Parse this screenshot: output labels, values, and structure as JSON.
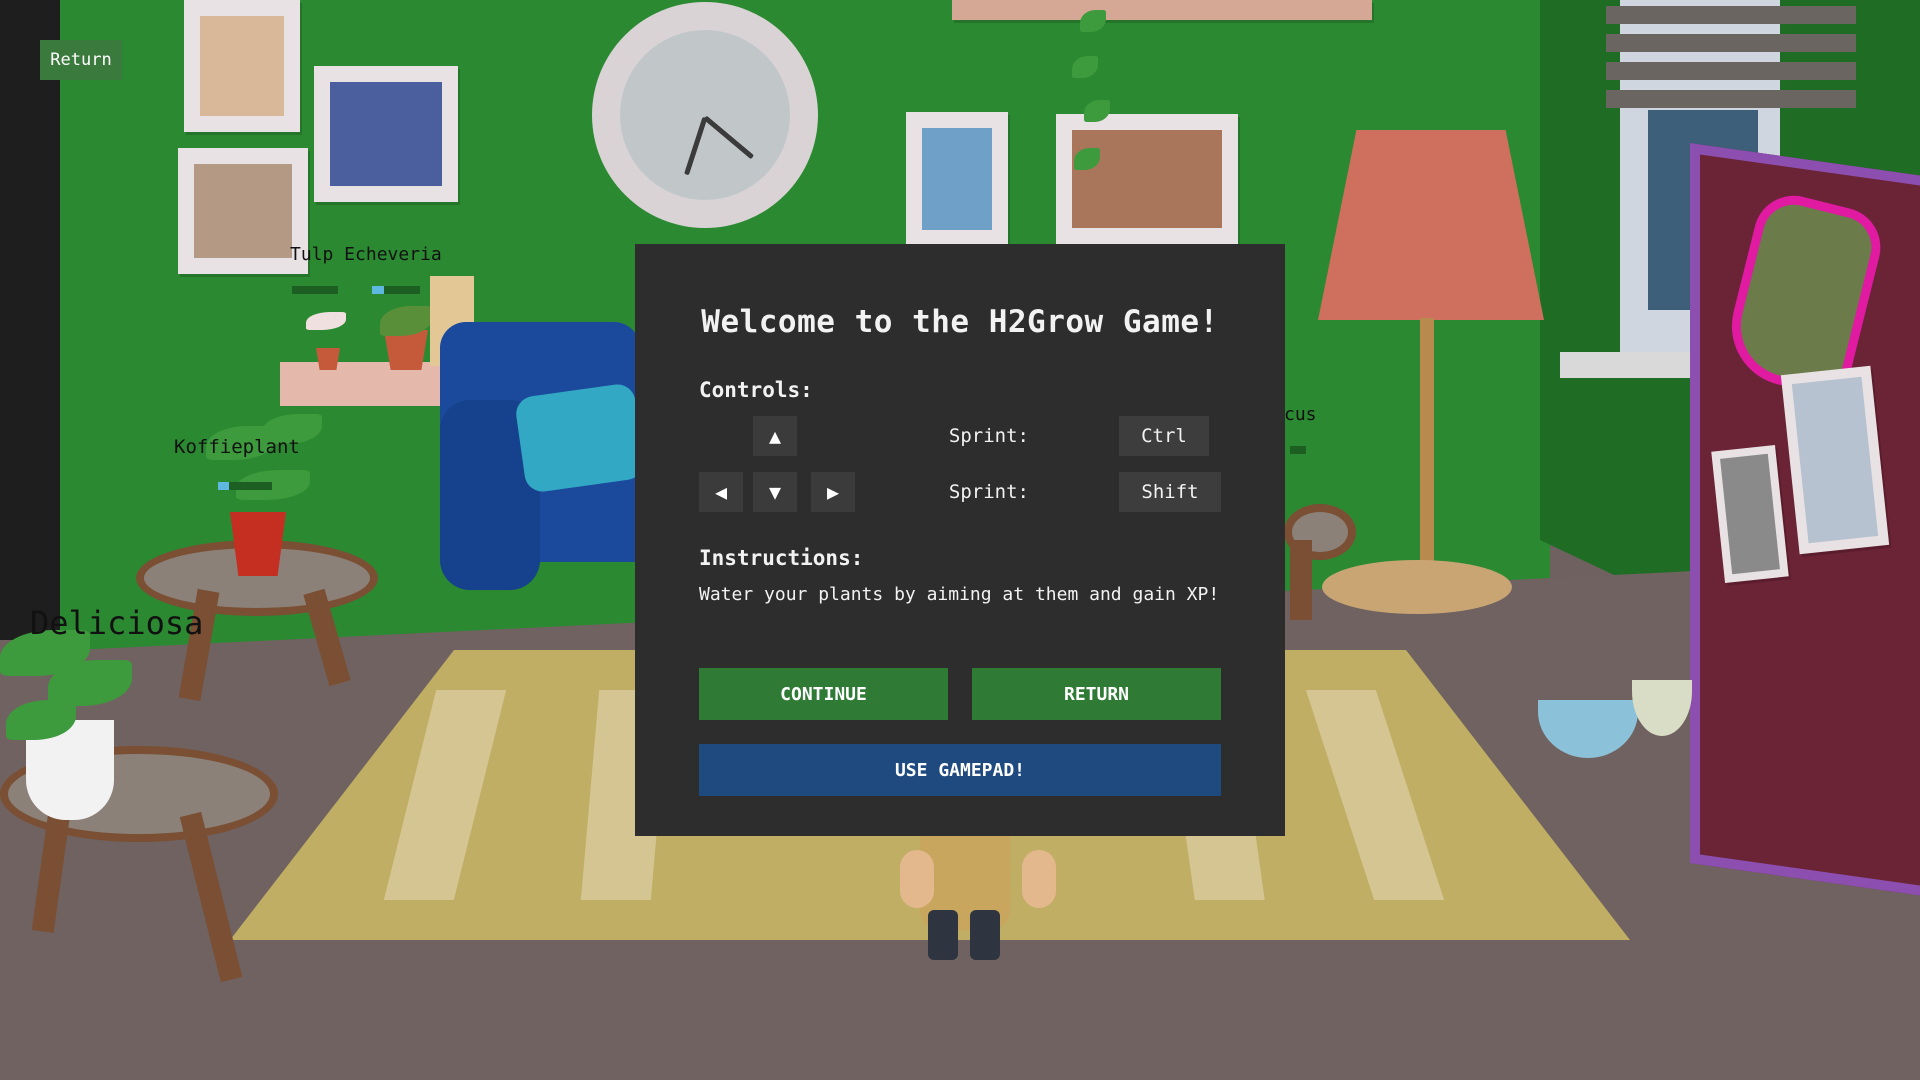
{
  "top_return_label": "Return",
  "world_labels": {
    "tulp": "Tulp Echeveria",
    "koffie": "Koffieplant",
    "deliciosa": "Deliciosa",
    "cus": "cus"
  },
  "plant_bars": {
    "tulp_left": 0.0,
    "tulp_right": 0.25,
    "koffie": 0.2
  },
  "modal": {
    "title": "Welcome to the H2Grow Game!",
    "controls_heading": "Controls:",
    "keys": {
      "up": "▲",
      "left": "◀",
      "down": "▼",
      "right": "▶"
    },
    "sprint_rows": [
      {
        "label": "Sprint:",
        "key": "Ctrl"
      },
      {
        "label": "Sprint:",
        "key": "Shift"
      }
    ],
    "instructions_heading": "Instructions:",
    "instructions_text": "Water your plants by aiming at them and gain XP!",
    "continue_label": "CONTINUE",
    "return_label": "RETURN",
    "gamepad_label": "USE GAMEPAD!"
  },
  "colors": {
    "wall": "#2b8a31",
    "modal_bg": "#2d2d2d",
    "button_green": "#2f7a35",
    "button_blue": "#1f4a80"
  }
}
